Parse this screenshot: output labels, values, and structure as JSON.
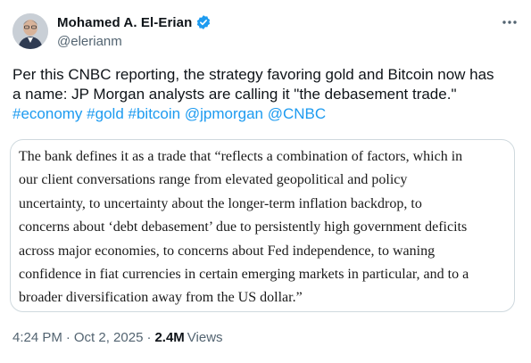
{
  "author": {
    "name": "Mohamed A. El-Erian",
    "handle": "@elerianm"
  },
  "tweet": {
    "text_lines": [
      "Per this CNBC reporting, the strategy favoring gold and Bitcoin now has",
      "a name: JP Morgan analysts are calling it \"the debasement trade.\""
    ],
    "tags": [
      "#economy",
      "#gold",
      "#bitcoin",
      "@jpmorgan",
      "@CNBC"
    ]
  },
  "quote": {
    "lines": [
      "The bank defines it as a trade that “reflects a combination of factors, which in",
      "our client conversations range from elevated geopolitical and policy",
      "uncertainty, to uncertainty about the longer-term inflation backdrop, to",
      "concerns about ‘debt debasement’ due to persistently high government deficits",
      "across major economies, to concerns about Fed independence, to waning",
      "confidence in fiat currencies in certain emerging markets in particular, and to a",
      "broader diversification away from the US dollar.”"
    ]
  },
  "meta": {
    "time": "4:24 PM",
    "separator": "·",
    "date": "Oct 2, 2025",
    "views_count": "2.4M",
    "views_label": "Views"
  },
  "icons": {
    "verified": "verified-badge-icon",
    "more": "more-options-icon"
  },
  "colors": {
    "link": "#1d9bf0",
    "secondary_text": "#536471",
    "primary_text": "#0f1419",
    "border": "#cfd9de"
  }
}
